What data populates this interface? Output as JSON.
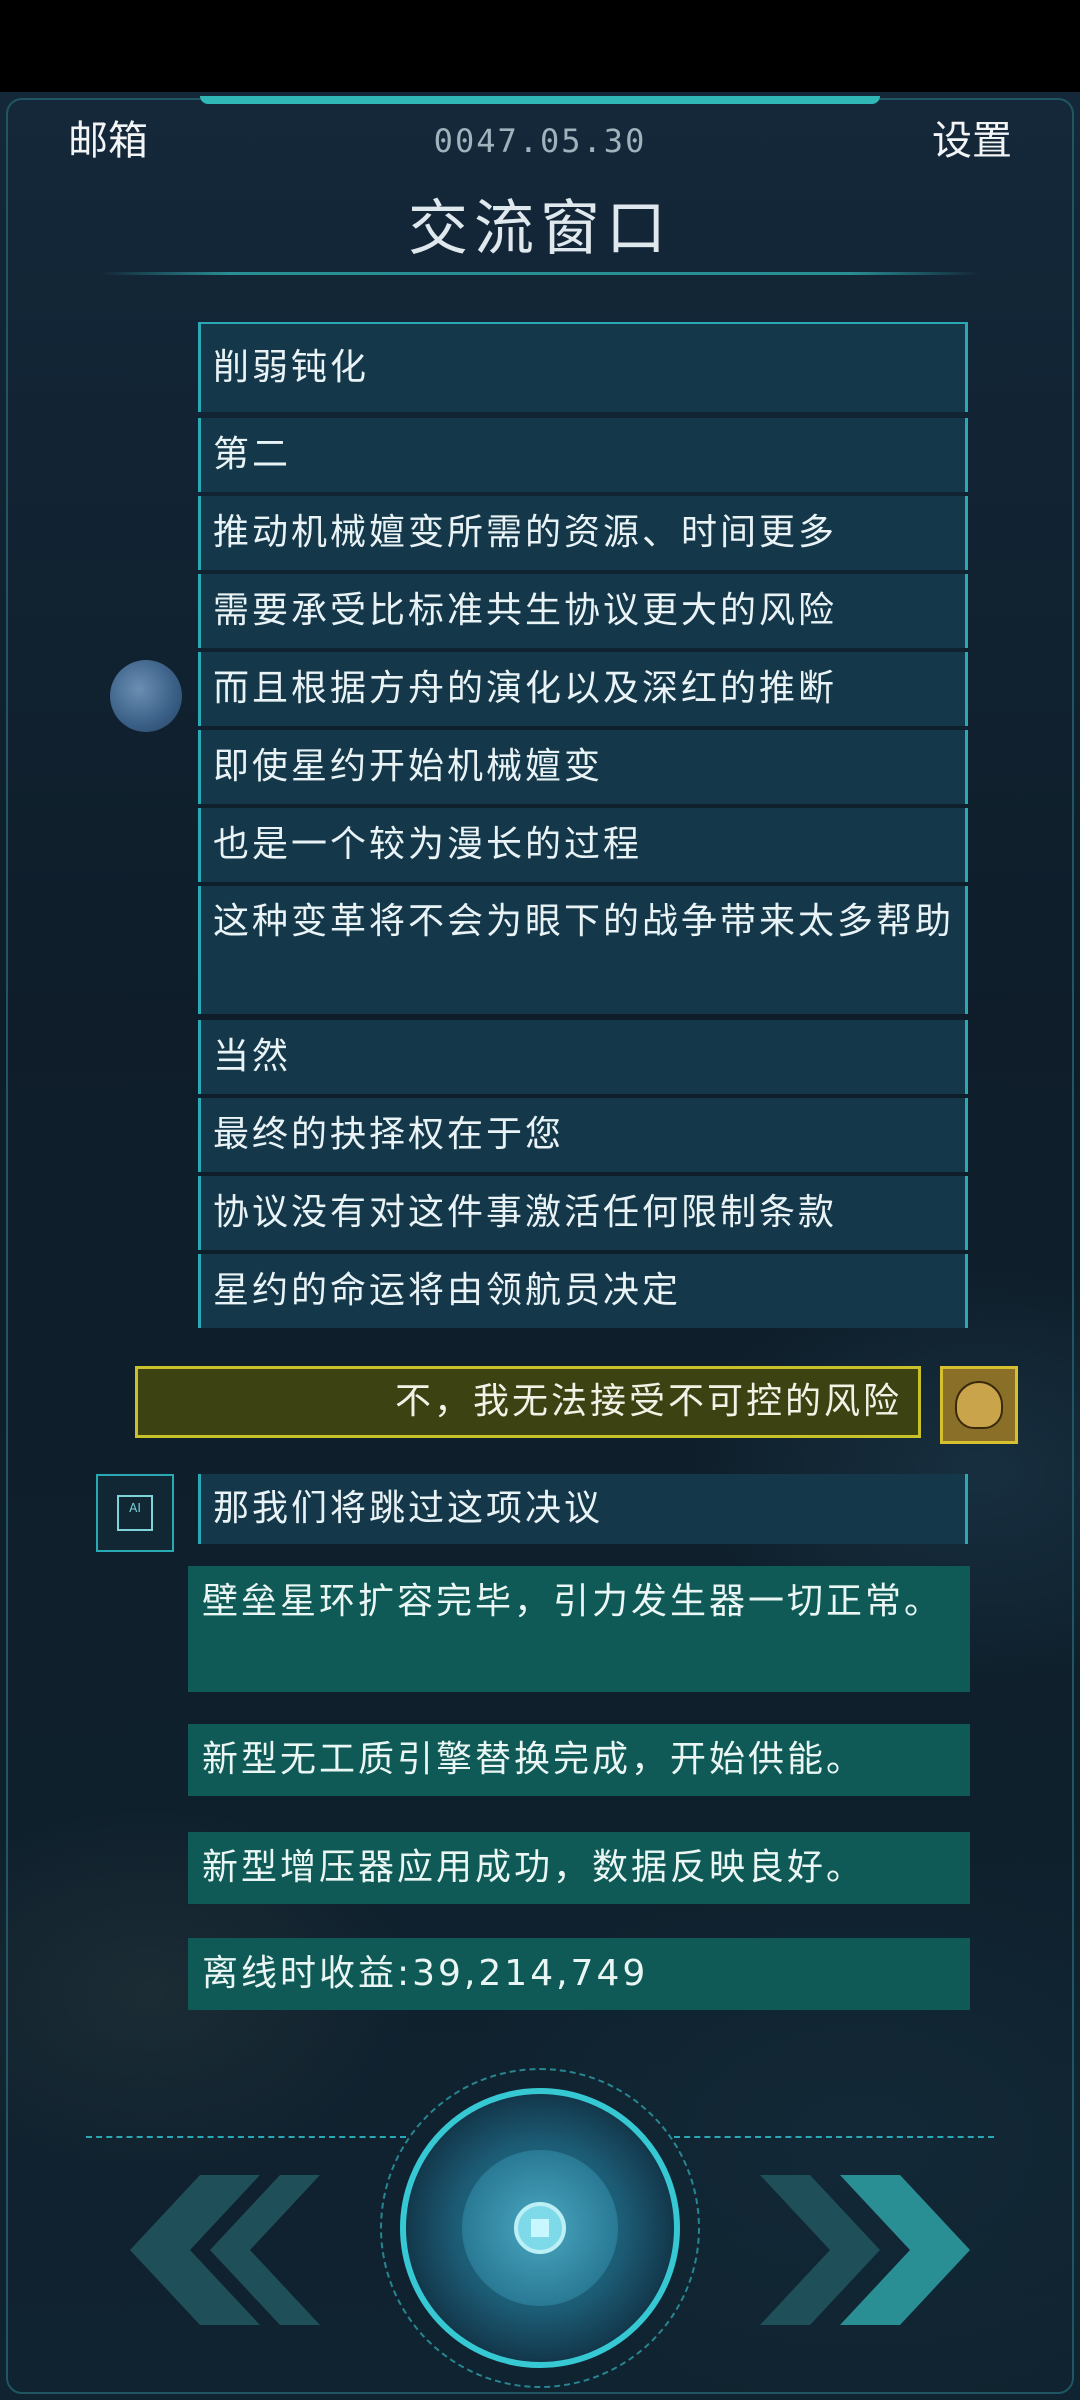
{
  "header": {
    "mailbox_label": "邮箱",
    "date": "0047.05.30",
    "settings_label": "设置",
    "title": "交流窗口"
  },
  "dialogue": [
    "削弱钝化",
    "第二",
    "推动机械嬗变所需的资源、时间更多",
    "需要承受比标准共生协议更大的风险",
    "而且根据方舟的演化以及深红的推断",
    "即使星约开始机械嬗变",
    "也是一个较为漫长的过程",
    "这种变革将不会为眼下的战争带来太多帮助",
    "当然",
    "最终的抉择权在于您",
    "协议没有对这件事激活任何限制条款",
    "星约的命运将由领航员决定"
  ],
  "player_choice": "不，我无法接受不可控的风险",
  "ai_reply": "那我们将跳过这项决议",
  "ai_badge_text": "AI",
  "system_messages": [
    "壁垒星环扩容完毕，引力发生器一切正常。",
    "新型无工质引擎替换完成，开始供能。",
    "新型增压器应用成功，数据反映良好。",
    "离线时收益:39,214,749"
  ],
  "colors": {
    "accent": "#2aa9b5",
    "dialogue_bg": "#14384a",
    "player_bg": "#3d4212",
    "player_border": "#c9c12a",
    "system_bg": "#0f5a57"
  }
}
